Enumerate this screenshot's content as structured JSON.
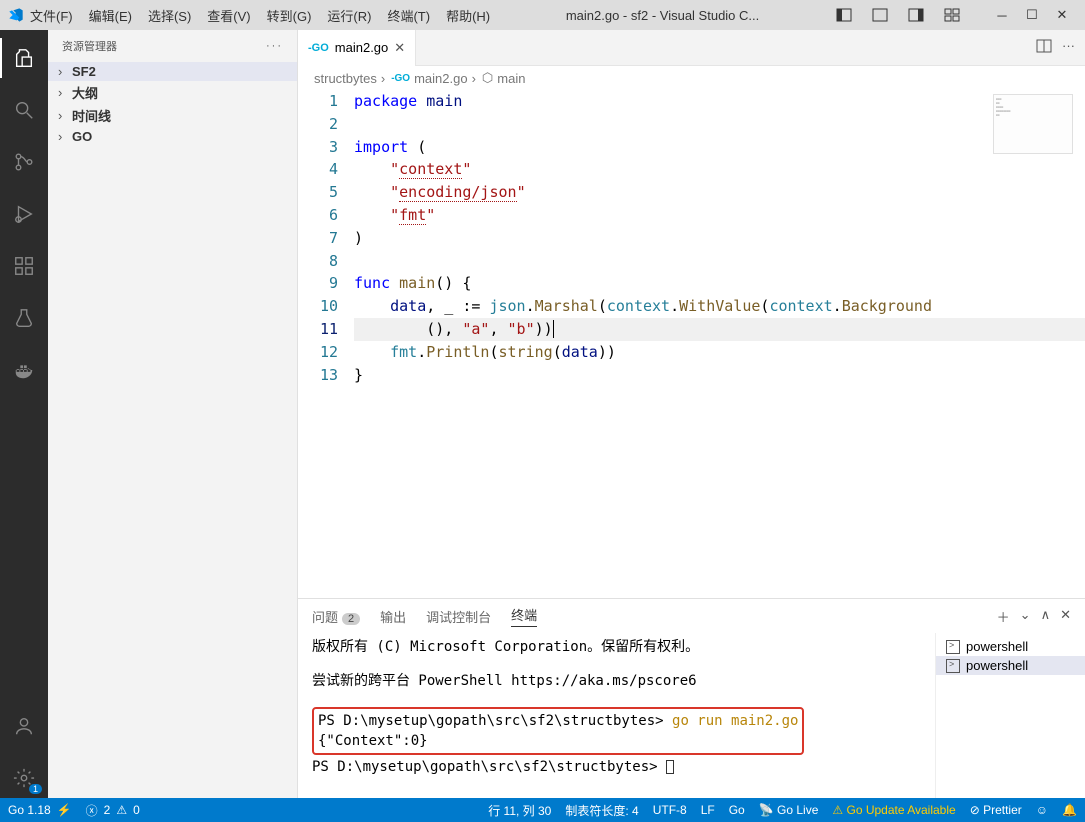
{
  "titlebar": {
    "menus": [
      "文件(F)",
      "编辑(E)",
      "选择(S)",
      "查看(V)",
      "转到(G)",
      "运行(R)",
      "终端(T)",
      "帮助(H)"
    ],
    "title": "main2.go - sf2 - Visual Studio C..."
  },
  "sidebar": {
    "header": "资源管理器",
    "items": [
      {
        "label": "SF2",
        "bold": true
      },
      {
        "label": "大纲",
        "bold": true
      },
      {
        "label": "时间线",
        "bold": true
      },
      {
        "label": "GO",
        "bold": true
      }
    ]
  },
  "tab": {
    "filename": "main2.go"
  },
  "breadcrumb": {
    "seg1": "structbytes",
    "seg2": "main2.go",
    "seg3": "main"
  },
  "code": {
    "lines": 13,
    "content": [
      [
        [
          "kw",
          "package"
        ],
        [
          "sp",
          " "
        ],
        [
          "name",
          "main"
        ]
      ],
      [],
      [
        [
          "kw",
          "import"
        ],
        [
          "sp",
          " "
        ],
        [
          "punc",
          "("
        ]
      ],
      [
        [
          "sp",
          "    "
        ],
        [
          "str",
          "\""
        ],
        [
          "str_err",
          "context"
        ],
        [
          "str",
          "\""
        ]
      ],
      [
        [
          "sp",
          "    "
        ],
        [
          "str",
          "\""
        ],
        [
          "str_err",
          "encoding/json"
        ],
        [
          "str",
          "\""
        ]
      ],
      [
        [
          "sp",
          "    "
        ],
        [
          "str",
          "\""
        ],
        [
          "str_err",
          "fmt"
        ],
        [
          "str",
          "\""
        ]
      ],
      [
        [
          "punc",
          ")"
        ]
      ],
      [],
      [
        [
          "kw",
          "func"
        ],
        [
          "sp",
          " "
        ],
        [
          "fn",
          "main"
        ],
        [
          "punc",
          "() {"
        ]
      ],
      [
        [
          "sp",
          "    "
        ],
        [
          "var",
          "data"
        ],
        [
          "punc",
          ", _ := "
        ],
        [
          "ns",
          "json"
        ],
        [
          "punc",
          "."
        ],
        [
          "fn",
          "Marshal"
        ],
        [
          "punc",
          "("
        ],
        [
          "ns",
          "context"
        ],
        [
          "punc",
          "."
        ],
        [
          "fn",
          "WithValue"
        ],
        [
          "punc",
          "("
        ],
        [
          "ns",
          "context"
        ],
        [
          "punc",
          "."
        ],
        [
          "fn",
          "Background"
        ]
      ],
      [
        [
          "sp",
          "        "
        ],
        [
          "punc",
          "(), "
        ],
        [
          "str",
          "\"a\""
        ],
        [
          "punc",
          ", "
        ],
        [
          "str",
          "\"b\""
        ],
        [
          "punc",
          "))"
        ]
      ],
      [
        [
          "sp",
          "    "
        ],
        [
          "ns",
          "fmt"
        ],
        [
          "punc",
          "."
        ],
        [
          "fn",
          "Println"
        ],
        [
          "punc",
          "("
        ],
        [
          "fn",
          "string"
        ],
        [
          "punc",
          "("
        ],
        [
          "var",
          "data"
        ],
        [
          "punc",
          "))"
        ]
      ],
      [
        [
          "punc",
          "}"
        ]
      ]
    ],
    "current_line": 11
  },
  "panel": {
    "tabs": [
      "问题",
      "输出",
      "调试控制台",
      "终端"
    ],
    "problem_count": "2",
    "active": 3
  },
  "terminal": {
    "l1": "版权所有 (C) Microsoft Corporation。保留所有权利。",
    "l2": "尝试新的跨平台 PowerShell https://aka.ms/pscore6",
    "prompt1": "PS D:\\mysetup\\gopath\\src\\sf2\\structbytes>",
    "cmd": "go run main2.go",
    "out": "{\"Context\":0}",
    "prompt2": "PS D:\\mysetup\\gopath\\src\\sf2\\structbytes>",
    "side": [
      "powershell",
      "powershell"
    ]
  },
  "status": {
    "go_version": "Go 1.18",
    "errors": "2",
    "warnings": "0",
    "pos": "行 11, 列 30",
    "tab": "制表符长度: 4",
    "enc": "UTF-8",
    "eol": "LF",
    "lang": "Go",
    "golive": "Go Live",
    "update": "Go Update Available",
    "prettier": "Prettier"
  }
}
